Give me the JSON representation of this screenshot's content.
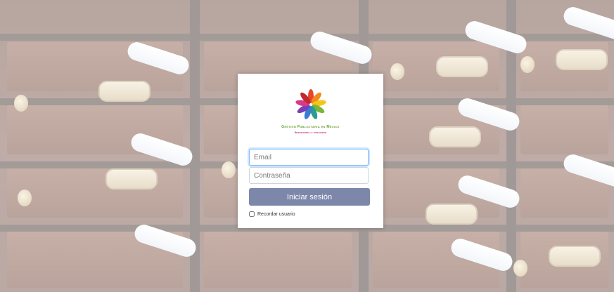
{
  "login": {
    "brand_line1": "Gestión Publicitaria en México",
    "brand_line2": "Integrando la publicidad",
    "email_placeholder": "Email",
    "password_placeholder": "Contraseña",
    "submit_label": "Iniciar sesión",
    "remember_label": "Recordar usuario"
  },
  "colors": {
    "button": "#7d87aa",
    "brand_green": "#6a9b2e",
    "brand_pink": "#c02a7a"
  },
  "icons": {
    "logo": "hands-logo-icon"
  }
}
